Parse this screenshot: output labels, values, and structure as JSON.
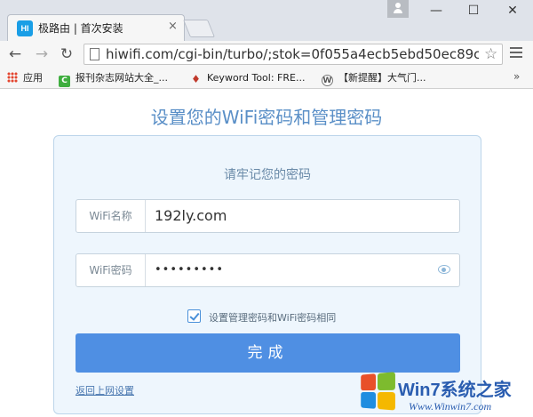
{
  "browser": {
    "tab": {
      "favicon": "HI",
      "title": "极路由 | 首次安装",
      "close": "×"
    },
    "window_controls": {
      "minimize": "—",
      "maximize": "☐",
      "close": "✕"
    },
    "nav": {
      "back": "←",
      "forward": "→",
      "reload": "↻"
    },
    "url": "hiwifi.com/cgi-bin/turbo/;stok=0f055a4ecb5ebd50ec89c",
    "star": "☆",
    "bookmarks": [
      {
        "label": "应用"
      },
      {
        "label": "报刊杂志网站大全_...",
        "icon": "C"
      },
      {
        "label": "Keyword Tool: FRE..."
      },
      {
        "label": "【新提醒】大气门...",
        "icon": "W"
      }
    ],
    "bookmarks_more": "»"
  },
  "page": {
    "heading": "设置您的WiFi密码和管理密码",
    "subtitle": "请牢记您的密码",
    "wifi_name": {
      "label": "WiFi名称",
      "value": "192ly.com"
    },
    "wifi_password": {
      "label": "WiFi密码",
      "value": "•••••••••"
    },
    "same_password": {
      "label": "设置管理密码和WiFi密码相同",
      "checked": true
    },
    "submit_label": "完成",
    "back_link": "返回上网设置"
  },
  "watermark": {
    "brand": "Win7系统之家",
    "url": "Www.Winwin7.com"
  },
  "colors": {
    "accent": "#4f8fe3",
    "heading": "#5a8fc7",
    "card_bg": "#eef6fd"
  }
}
